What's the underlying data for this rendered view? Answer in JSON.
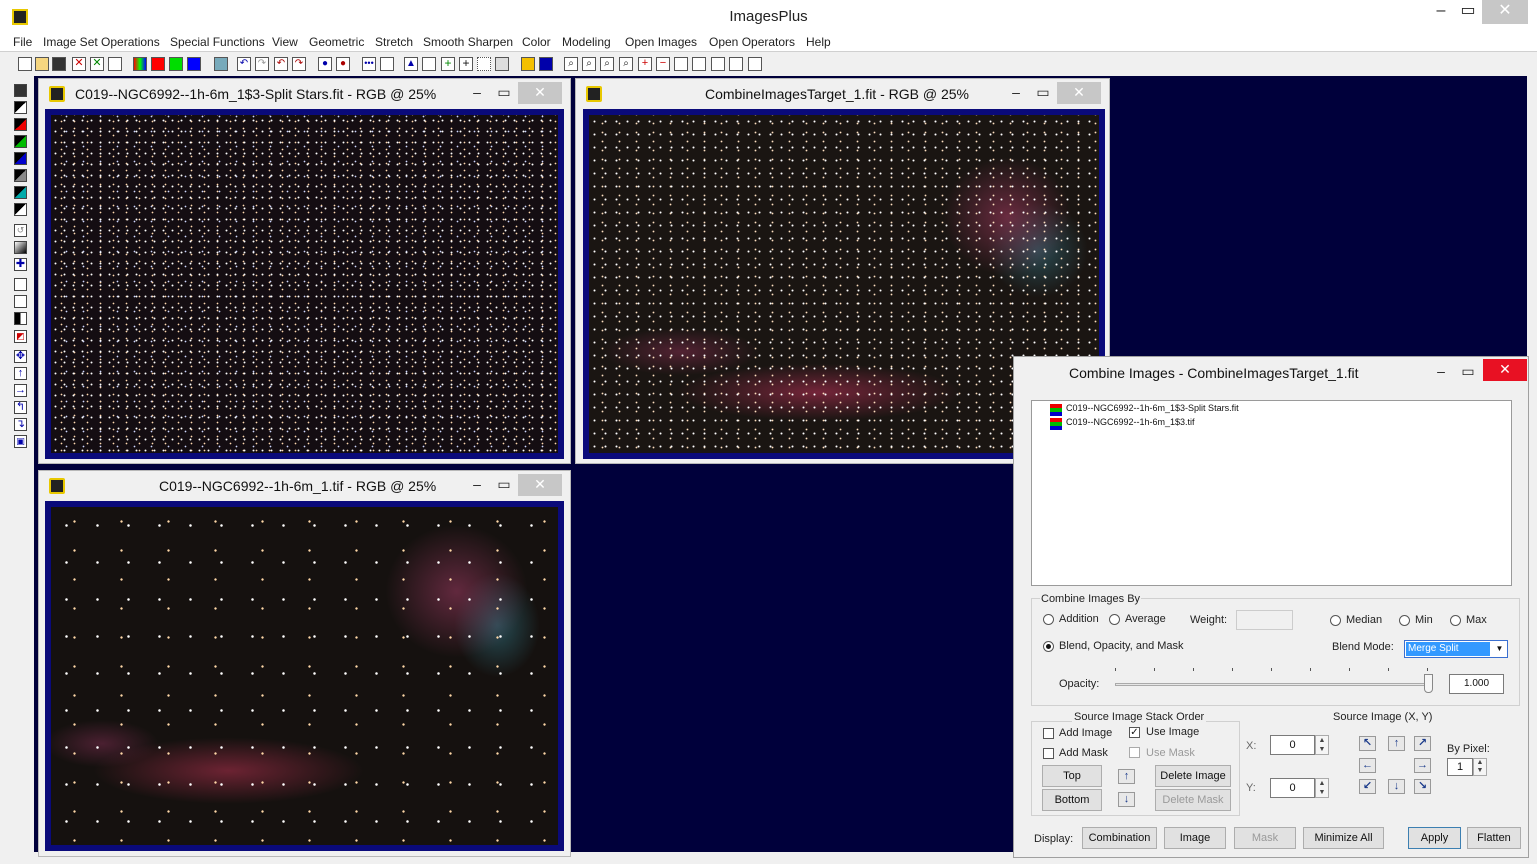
{
  "app": {
    "title": "ImagesPlus"
  },
  "menu": [
    "File",
    "Image Set Operations",
    "Special Functions",
    "View",
    "Geometric",
    "Stretch",
    "Smooth Sharpen",
    "Color",
    "Modeling",
    "Open Images",
    "Open Operators",
    "Help"
  ],
  "windows": {
    "w1": {
      "title": "C019--NGC6992--1h-6m_1$3-Split Stars.fit - RGB @ 25%"
    },
    "w2": {
      "title": "CombineImagesTarget_1.fit - RGB @ 25%"
    },
    "w3": {
      "title": "C019--NGC6992--1h-6m_1.tif - RGB @ 25%"
    }
  },
  "dialog": {
    "title": "Combine Images - CombineImagesTarget_1.fit",
    "stack_items": [
      "C019--NGC6992--1h-6m_1$3-Split Stars.fit",
      "C019--NGC6992--1h-6m_1$3.tif"
    ],
    "combine_by_label": "Combine Images By",
    "addition": "Addition",
    "average": "Average",
    "weight_label": "Weight:",
    "median": "Median",
    "min": "Min",
    "max": "Max",
    "blend_label": "Blend, Opacity, and Mask",
    "blend_mode_label": "Blend Mode:",
    "blend_mode_value": "Merge Split",
    "opacity_label": "Opacity:",
    "opacity_value": "1.000",
    "opacity_level": 1.0,
    "stack_order_label": "Source Image Stack Order",
    "add_image": "Add Image",
    "use_image": "Use Image",
    "add_mask": "Add Mask",
    "use_mask": "Use Mask",
    "top_btn": "Top",
    "bottom_btn": "Bottom",
    "delete_image_btn": "Delete Image",
    "delete_mask_btn": "Delete Mask",
    "source_xy_label": "Source Image (X, Y)",
    "x_label": "X:",
    "y_label": "Y:",
    "x_value": "0",
    "y_value": "0",
    "by_pixel_label": "By Pixel:",
    "by_pixel_value": "1",
    "display_label": "Display:",
    "combination_btn": "Combination",
    "image_btn": "Image",
    "mask_btn": "Mask",
    "minimize_all_btn": "Minimize All",
    "apply_btn": "Apply",
    "flatten_btn": "Flatten"
  }
}
